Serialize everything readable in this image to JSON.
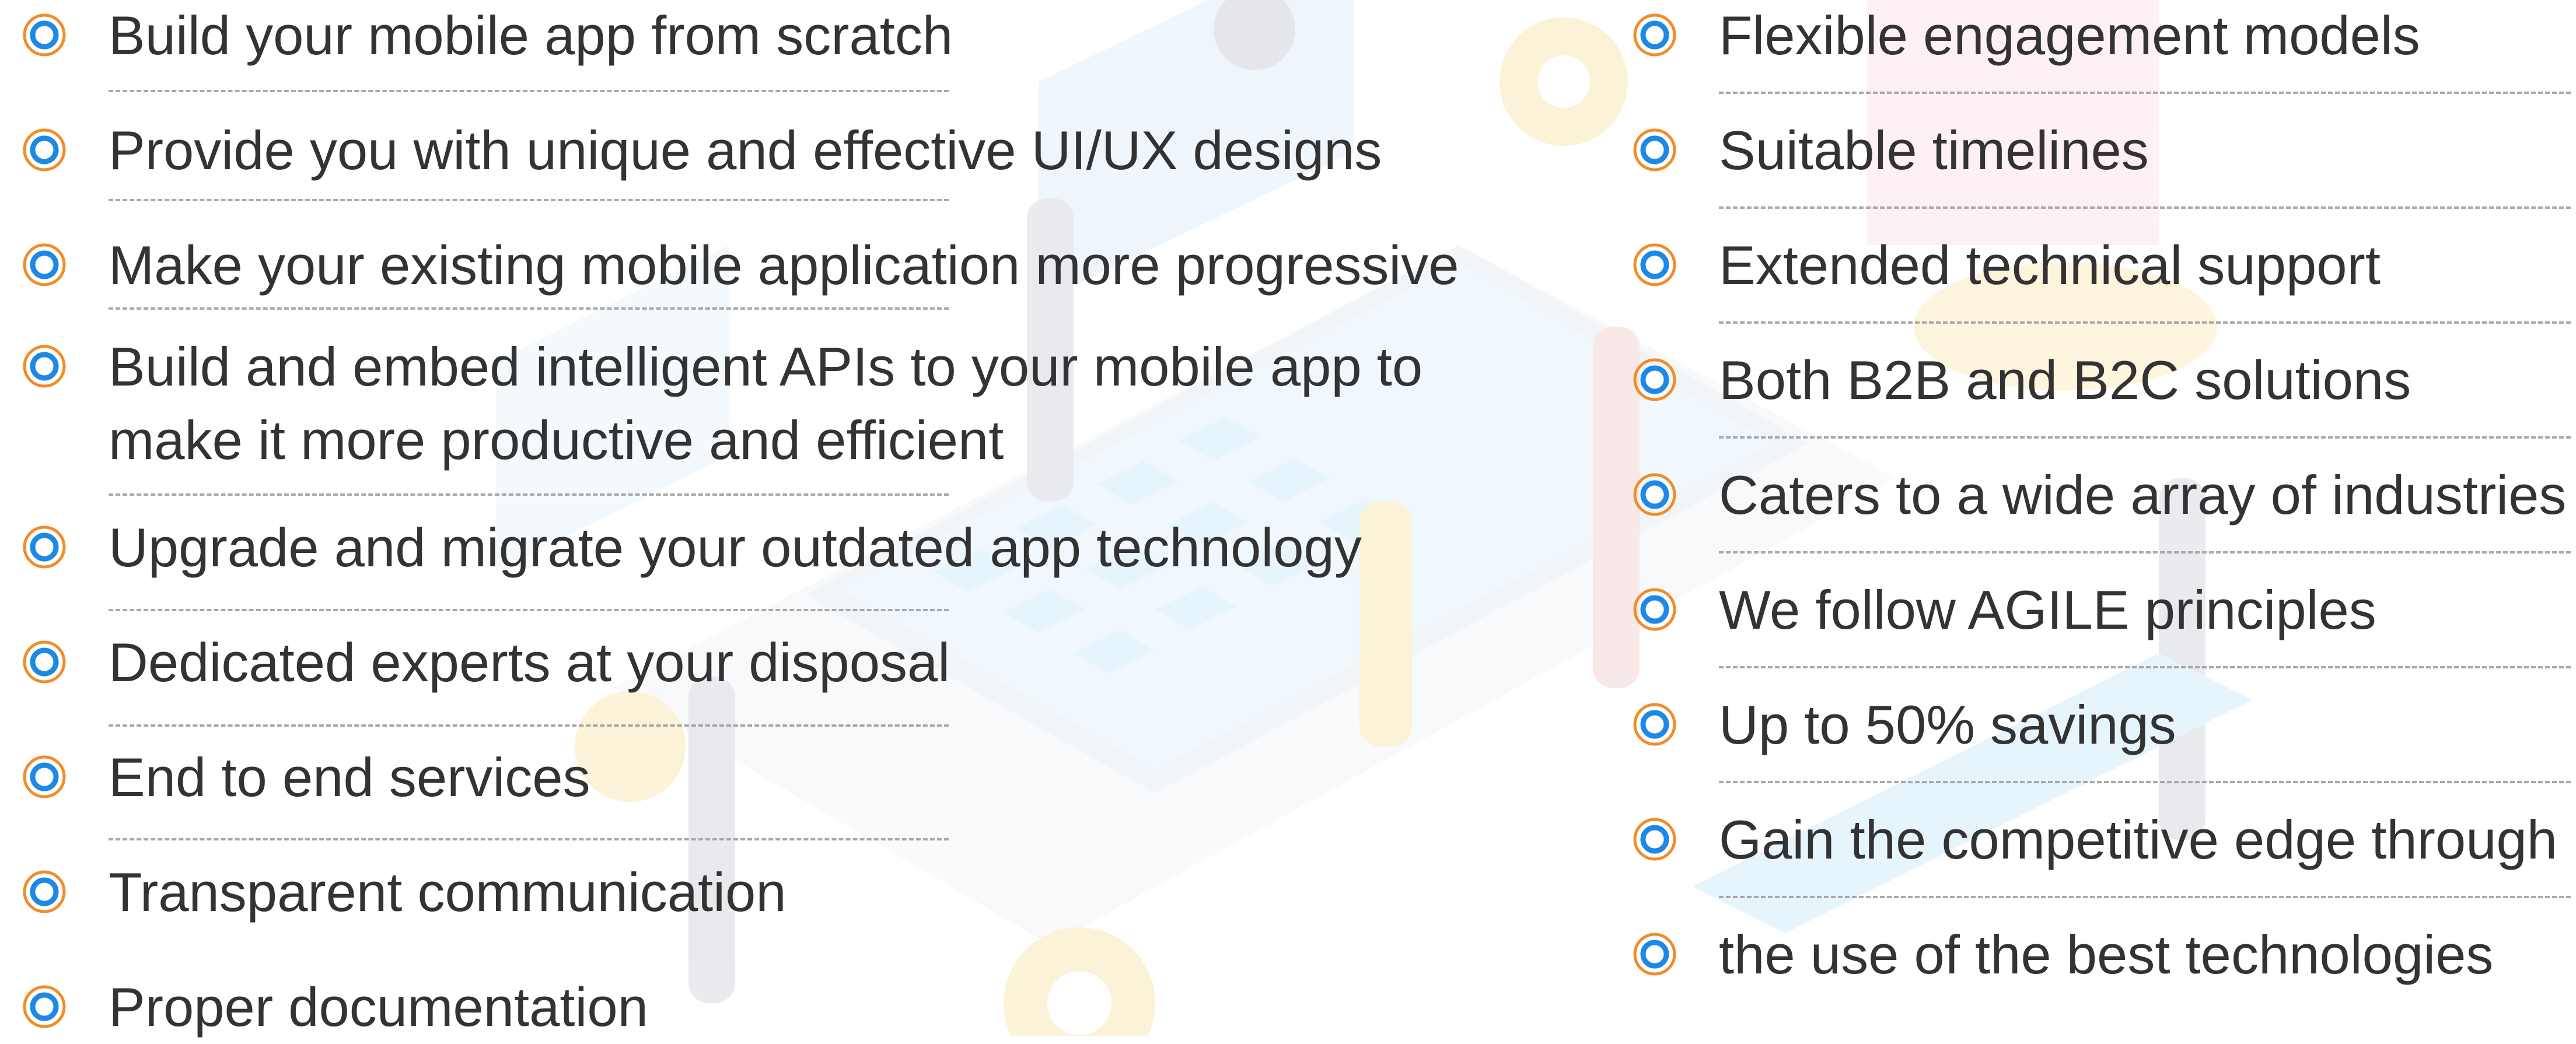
{
  "colors": {
    "bullet_ring_outer": "#f28c28",
    "bullet_ring_inner": "#1e88e5",
    "text": "#333333",
    "divider": "#a9a9a9"
  },
  "icons": {
    "bullet": "concentric-circle-bullet-icon"
  },
  "left_list": [
    {
      "label": "Build your mobile app from scratch"
    },
    {
      "label": "Provide you with unique and effective UI/UX designs"
    },
    {
      "label": "Make your existing mobile application more progressive"
    },
    {
      "label": "Build and embed intelligent APIs to your mobile app to",
      "label_line2": "make it more productive and efficient"
    },
    {
      "label": "Upgrade and migrate your outdated app technology"
    },
    {
      "label": "Dedicated experts at your disposal"
    },
    {
      "label": "End to end services"
    },
    {
      "label": "Transparent communication"
    },
    {
      "label": "Proper documentation"
    }
  ],
  "right_list": [
    {
      "label": "Flexible engagement models"
    },
    {
      "label": "Suitable timelines"
    },
    {
      "label": "Extended technical support"
    },
    {
      "label": "Both B2B and B2C solutions"
    },
    {
      "label": "Caters to a wide array of industries"
    },
    {
      "label": "We follow AGILE principles"
    },
    {
      "label": "Up to 50% savings"
    },
    {
      "label": "Gain the competitive edge through"
    },
    {
      "label": "the use of the best technologies"
    }
  ]
}
